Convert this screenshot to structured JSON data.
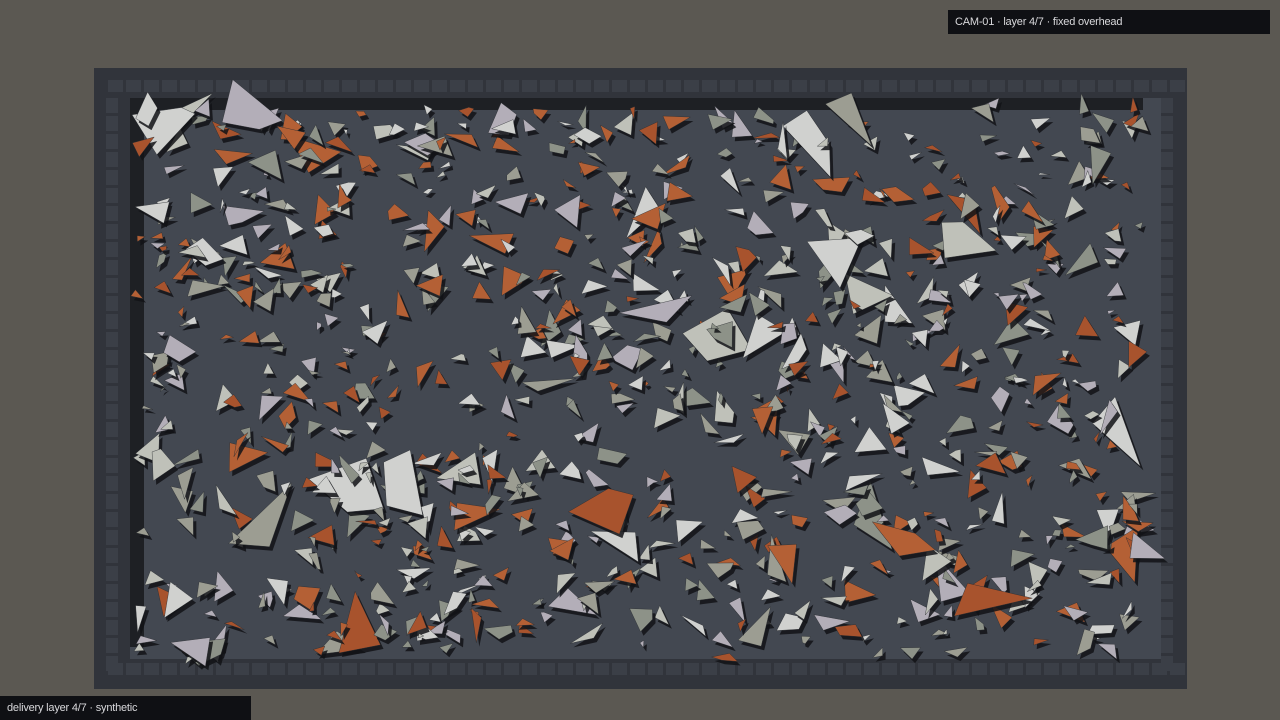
{
  "overlay": {
    "camera_label": "CAM-01 · layer 4/7 · fixed overhead",
    "delivery_label": "delivery layer 4/7 · synthetic"
  },
  "scene": {
    "background": "#5b5852",
    "bin_frame_color": "#31343b",
    "bin_floor_color": "#434851",
    "bin_wall_shadow_color": "#1e2024",
    "shard_palette": [
      "#a8532d",
      "#b46035",
      "#9c9d92",
      "#bfc1b9",
      "#b3aeb8",
      "#d0d1cf",
      "#8d9288"
    ]
  }
}
